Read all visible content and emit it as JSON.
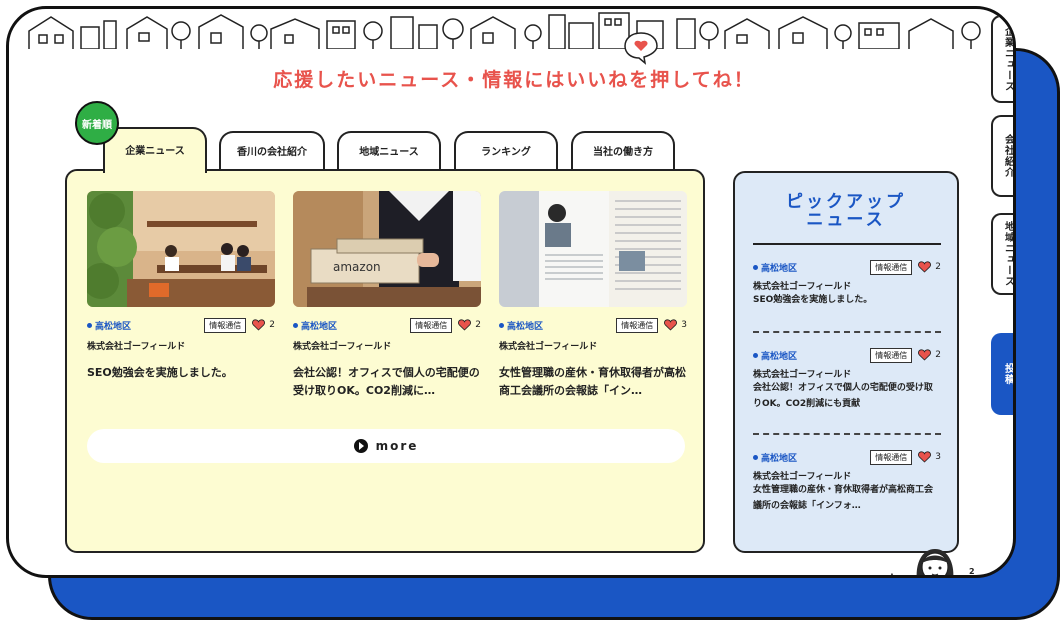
{
  "headline": "応援したいニュース・情報にはいいねを押してね！",
  "badge_new": "新着順",
  "tabs": [
    {
      "label": "企業ニュース"
    },
    {
      "label": "香川の会社紹介"
    },
    {
      "label": "地域ニュース"
    },
    {
      "label": "ランキング"
    },
    {
      "label": "当社の働き方"
    }
  ],
  "cards": [
    {
      "area": "高松地区",
      "tag": "情報通信",
      "likes": "2",
      "company": "株式会社ゴーフィールド",
      "title": "SEO勉強会を実施しました。"
    },
    {
      "area": "高松地区",
      "tag": "情報通信",
      "likes": "2",
      "company": "株式会社ゴーフィールド",
      "title": "会社公認！オフィスで個人の宅配便の受け取りOK。CO2削減に…",
      "photo_text": "amazon"
    },
    {
      "area": "高松地区",
      "tag": "情報通信",
      "likes": "3",
      "company": "株式会社ゴーフィールド",
      "title": "女性管理職の産休・育休取得者が高松商工会議所の会報誌「イン…"
    }
  ],
  "more_label": "more",
  "pickup": {
    "title_line1": "ピックアップ",
    "title_line2": "ニュース",
    "items": [
      {
        "area": "高松地区",
        "tag": "情報通信",
        "likes": "2",
        "company": "株式会社ゴーフィールド",
        "title": "SEO勉強会を実施しました。"
      },
      {
        "area": "高松地区",
        "tag": "情報通信",
        "likes": "2",
        "company": "株式会社ゴーフィールド",
        "title": "会社公認！オフィスで個人の宅配便の受け取りOK。CO2削減にも貢献"
      },
      {
        "area": "高松地区",
        "tag": "情報通信",
        "likes": "3",
        "company": "株式会社ゴーフィールド",
        "title": "女性管理職の産休・育休取得者が高松商工会議所の会報誌「インフォ…"
      }
    ]
  },
  "side_tabs": [
    {
      "label": "企業ニュース"
    },
    {
      "label": "会社紹介"
    },
    {
      "label": "地域ニュース"
    },
    {
      "label": "投稿"
    }
  ],
  "corner_marks": {
    "left": "∧",
    "right": "2"
  },
  "colors": {
    "accent_blue": "#1a56c4",
    "headline_red": "#e8534c",
    "panel_yellow": "#fdfcd2",
    "pickup_blue": "#dde9f7",
    "badge_green": "#2fae45",
    "heart_red": "#e8534c"
  }
}
